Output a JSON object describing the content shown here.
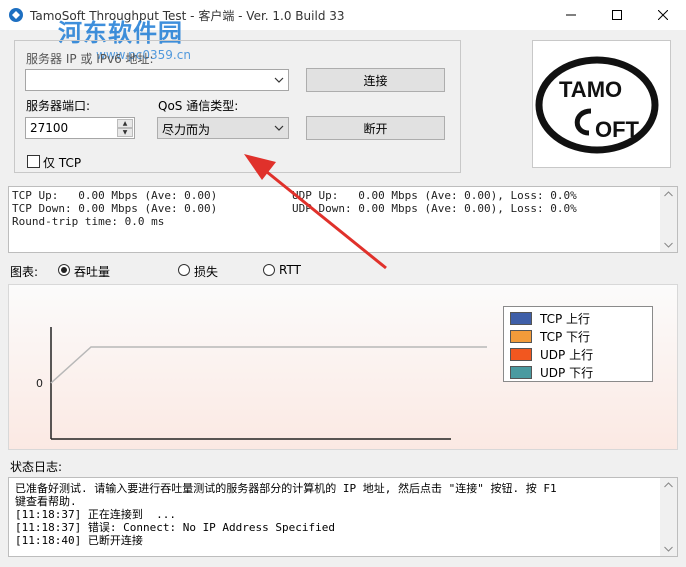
{
  "window": {
    "title": "TamoSoft Throughput Test - 客户端 - Ver. 1.0 Build 33"
  },
  "watermark": {
    "site_name": "河东软件园",
    "url": "www.pc0359.cn"
  },
  "connection": {
    "server_label": "服务器 IP 或 IPv6 地址:",
    "server_value": "",
    "port_label": "服务器端口:",
    "port_value": "27100",
    "qos_label": "QoS 通信类型:",
    "qos_value": "尽力而为",
    "tcp_only_label": "仅 TCP",
    "connect_label": "连接",
    "disconnect_label": "断开"
  },
  "logo": {
    "text_top": "TAMO",
    "text_bottom": "OFT"
  },
  "stats": {
    "tcp_up": "TCP Up:   0.00 Mbps (Ave: 0.00)",
    "tcp_down": "TCP Down: 0.00 Mbps (Ave: 0.00)",
    "rtt": "Round-trip time: 0.0 ms",
    "udp_up": "UDP Up:   0.00 Mbps (Ave: 0.00), Loss: 0.0%",
    "udp_down": "UDP Down: 0.00 Mbps (Ave: 0.00), Loss: 0.0%"
  },
  "chart_options": {
    "label": "图表:",
    "options": [
      "吞吐量",
      "损失",
      "RTT"
    ],
    "selected": "吞吐量"
  },
  "chart_data": {
    "type": "line",
    "y_tick_labels": [
      "0"
    ],
    "series": [
      {
        "name": "TCP 上行",
        "color": "#3f5fa8"
      },
      {
        "name": "TCP 下行",
        "color": "#f29b3a"
      },
      {
        "name": "UDP 上行",
        "color": "#f2571f"
      },
      {
        "name": "UDP 下行",
        "color": "#4a9aa0"
      }
    ],
    "legend_position": "top-right",
    "grid": false
  },
  "log": {
    "label": "状态日志:",
    "lines": [
      "已准备好测试. 请输入要进行吞吐量测试的服务器部分的计算机的 IP 地址, 然后点击 \"连接\" 按钮. 按 F1",
      "键查看帮助.",
      "[11:18:37] 正在连接到  ...",
      "[11:18:37] 错误: Connect: No IP Address Specified",
      "[11:18:40] 已断开连接"
    ]
  },
  "colors": {
    "arrow": "#e0312b"
  }
}
